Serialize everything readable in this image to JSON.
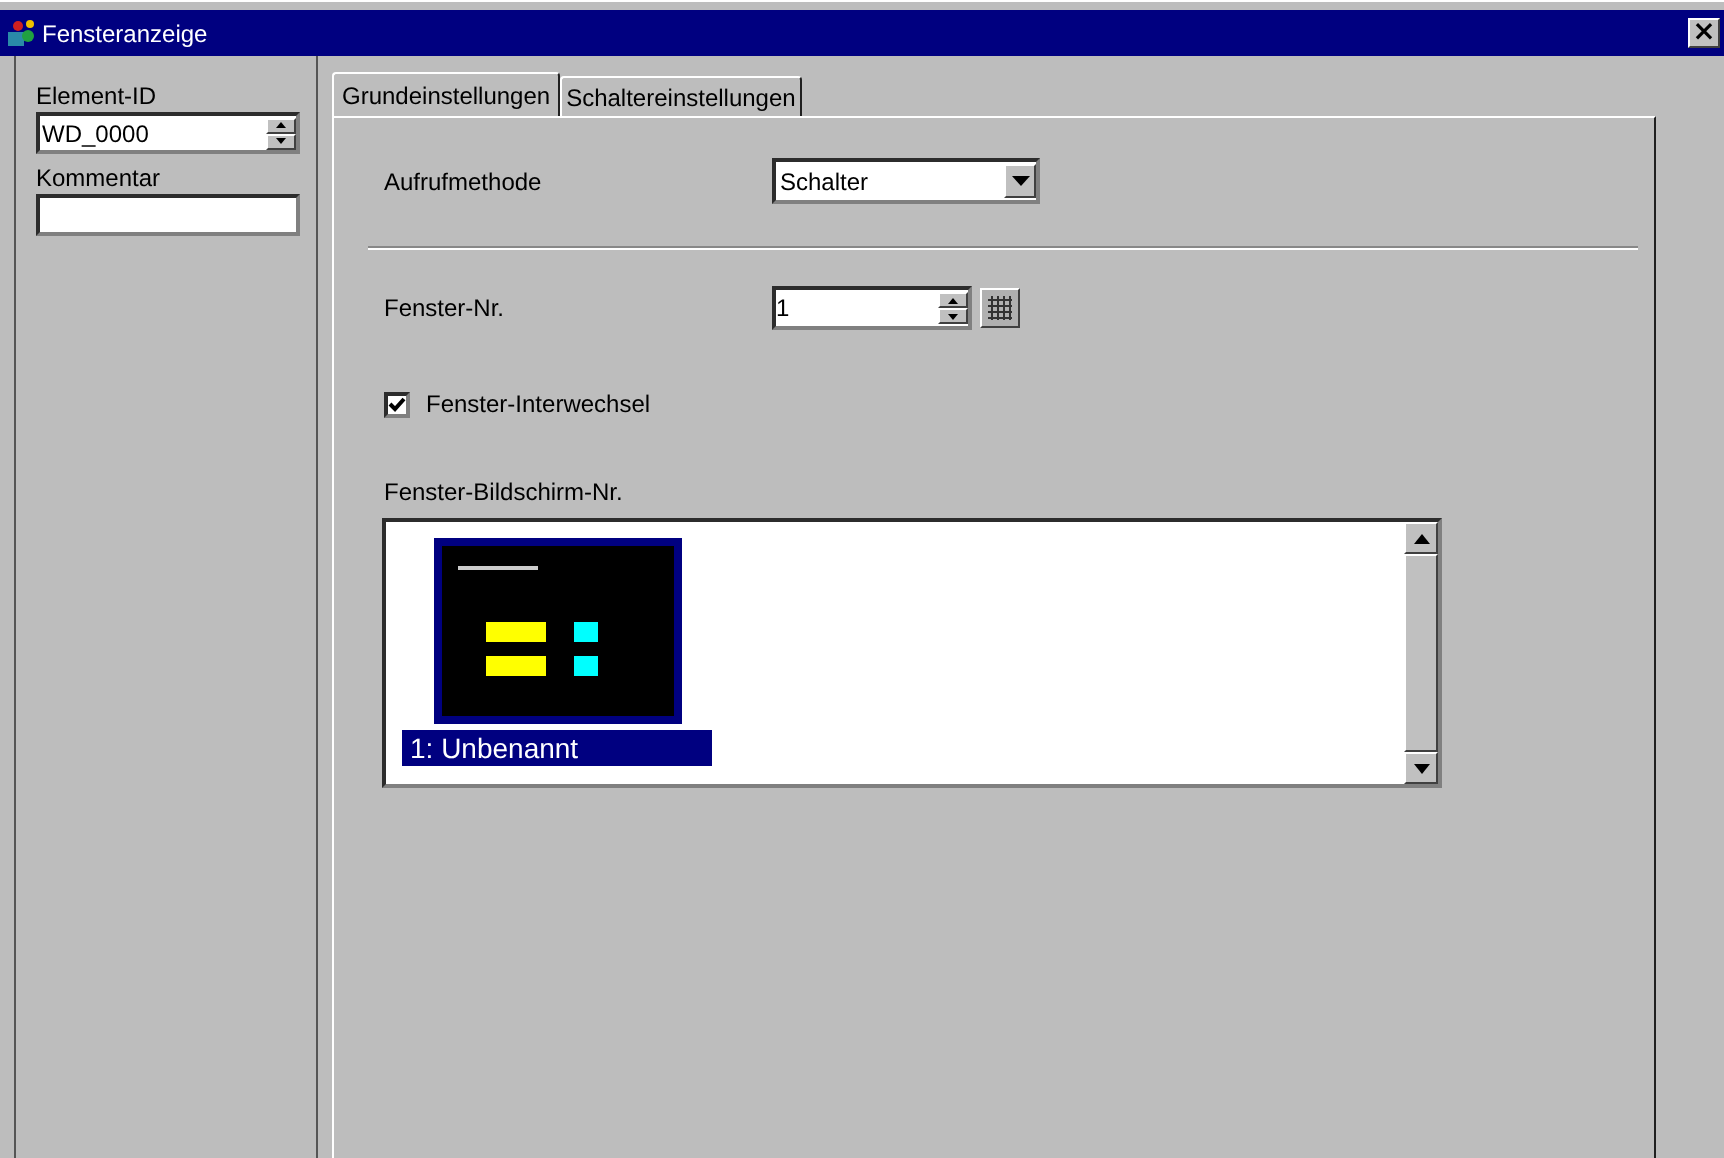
{
  "window": {
    "title": "Fensteranzeige",
    "close": "×"
  },
  "sidebar": {
    "fields": [
      {
        "label": "Element-ID",
        "value": "WD_0000",
        "kind": "spin"
      },
      {
        "label": "Kommentar",
        "kind": "text"
      }
    ]
  },
  "tabs": [
    {
      "label": "Grundeinstellungen",
      "selected": true
    },
    {
      "label": "Schaltereinstellungen",
      "selected": false
    }
  ],
  "call_method": {
    "label": "Aufrufmethode",
    "value": "Schalter"
  },
  "window_number": {
    "label": "Fenster-Nr.",
    "value": "1"
  },
  "interchange": {
    "label": "Fenster-Interwechsel",
    "checked": true
  },
  "screen_list": {
    "label": "Fenster-Bildschirm-Nr.",
    "items": [
      {
        "label": "1: Unbenannt",
        "selected": true
      }
    ]
  }
}
